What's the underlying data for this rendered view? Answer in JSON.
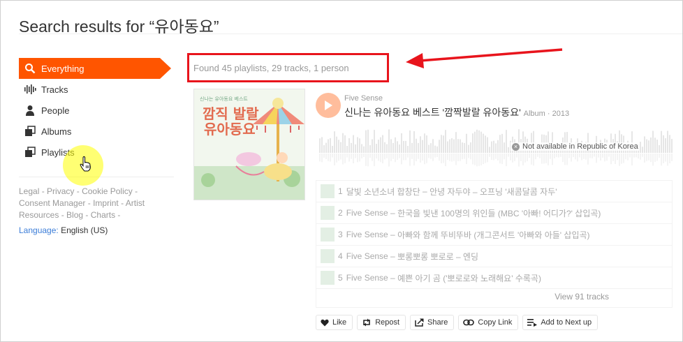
{
  "page": {
    "title": "Search results for “유아동요”"
  },
  "sidebar": {
    "items": [
      {
        "label": "Everything",
        "icon": "search-icon",
        "active": true
      },
      {
        "label": "Tracks",
        "icon": "waveform-icon"
      },
      {
        "label": "People",
        "icon": "person-icon"
      },
      {
        "label": "Albums",
        "icon": "stacked-squares-icon"
      },
      {
        "label": "Playlists",
        "icon": "stacked-squares-icon"
      }
    ],
    "footer": {
      "links": [
        "Legal",
        "Privacy",
        "Cookie Policy",
        "Consent Manager",
        "Imprint",
        "Artist Resources",
        "Blog",
        "Charts"
      ],
      "language_label": "Language:",
      "language_value": "English (US)"
    }
  },
  "results": {
    "summary": "Found 45 playlists, 29 tracks, 1 person",
    "album": {
      "artist": "Five Sense",
      "title": "신나는 유아동요 베스트 '깜짝발랄 유아동요'",
      "meta": "Album · 2013",
      "not_available": "Not available in Republic of Korea",
      "artwork_text": "깜짝발랄 유아동요",
      "tracks": [
        {
          "num": "1",
          "artist": "달빛 소년소녀 합창단",
          "title": "안녕 자두야 – 오프닝 '새콤달콤 자두'"
        },
        {
          "num": "2",
          "artist": "Five Sense",
          "title": "한국을 빛낸 100명의 위인들 (MBC '아빠! 어디가?' 삽입곡)"
        },
        {
          "num": "3",
          "artist": "Five Sense",
          "title": "아빠와 함께 뚜비뚜바 (개그콘서트 '아빠와 아들' 삽입곡)"
        },
        {
          "num": "4",
          "artist": "Five Sense",
          "title": "뽀롱뽀롱 뽀로로 – 엔딩"
        },
        {
          "num": "5",
          "artist": "Five Sense",
          "title": "예쁜 아기 곰 ('뽀로로와 노래해요' 수록곡)"
        }
      ],
      "view_tracks": "View 91 tracks"
    },
    "actions": [
      {
        "label": "Like",
        "icon": "heart-icon"
      },
      {
        "label": "Repost",
        "icon": "repost-icon"
      },
      {
        "label": "Share",
        "icon": "share-icon"
      },
      {
        "label": "Copy Link",
        "icon": "link-icon"
      },
      {
        "label": "Add to Next up",
        "icon": "add-to-queue-icon"
      }
    ]
  },
  "colors": {
    "accent": "#ff5500",
    "annotation": "#e8141c",
    "link": "#3b7dd8"
  }
}
